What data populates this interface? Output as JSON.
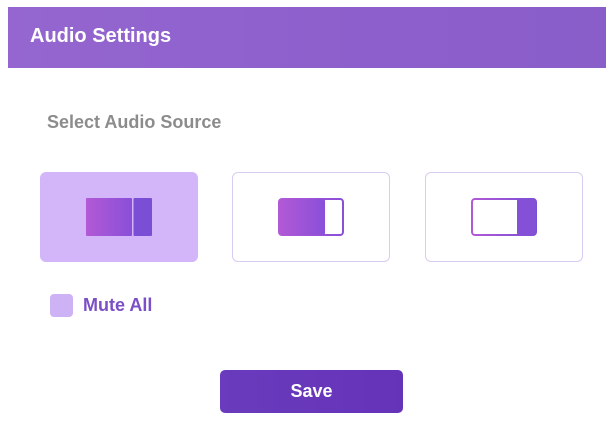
{
  "dialog": {
    "title": "Audio Settings"
  },
  "audio_source": {
    "label": "Select Audio Source",
    "options": [
      {
        "icon": "dual-panel-icon",
        "selected": true
      },
      {
        "icon": "left-panel-icon",
        "selected": false
      },
      {
        "icon": "right-panel-icon",
        "selected": false
      }
    ]
  },
  "mute": {
    "label": "Mute All",
    "checked": false
  },
  "actions": {
    "save_label": "Save"
  },
  "colors": {
    "header": "#8c5fcc",
    "accent": "#6a3bbd",
    "selected_option": "#d2b6f9",
    "icon_gradient_start": "#b259d6",
    "icon_gradient_end": "#7a4fd6",
    "label_gray": "#8c8c8c"
  }
}
